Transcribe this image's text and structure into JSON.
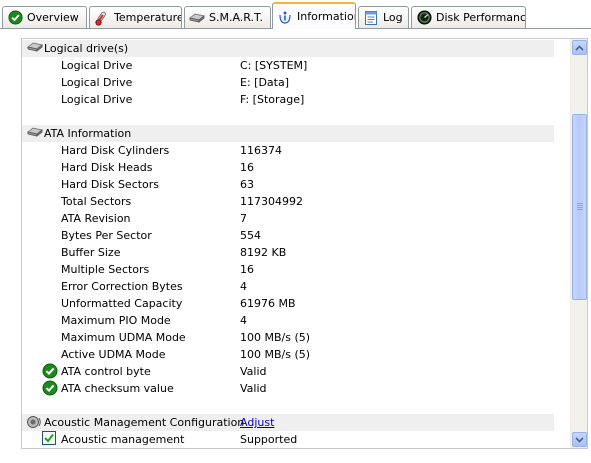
{
  "tabs": [
    {
      "label": "Overview",
      "icon": "check-circle-icon",
      "active": false
    },
    {
      "label": "Temperature",
      "icon": "thermometer-icon",
      "active": false
    },
    {
      "label": "S.M.A.R.T.",
      "icon": "hard-disk-icon",
      "active": false
    },
    {
      "label": "Information",
      "icon": "info-icon",
      "active": true
    },
    {
      "label": "Log",
      "icon": "document-icon",
      "active": false
    },
    {
      "label": "Disk Performance",
      "icon": "gauge-icon",
      "active": false
    }
  ],
  "logical": {
    "header": "Logical drive(s)",
    "rows": [
      {
        "key": "Logical Drive",
        "value": "C: [SYSTEM]"
      },
      {
        "key": "Logical Drive",
        "value": "E: [Data]"
      },
      {
        "key": "Logical Drive",
        "value": "F: [Storage]"
      }
    ]
  },
  "ata": {
    "header": "ATA Information",
    "rows": [
      {
        "key": "Hard Disk Cylinders",
        "value": "116374"
      },
      {
        "key": "Hard Disk Heads",
        "value": "16"
      },
      {
        "key": "Hard Disk Sectors",
        "value": "63"
      },
      {
        "key": "Total Sectors",
        "value": "117304992"
      },
      {
        "key": "ATA Revision",
        "value": "7"
      },
      {
        "key": "Bytes Per Sector",
        "value": "554"
      },
      {
        "key": "Buffer Size",
        "value": "8192 KB"
      },
      {
        "key": "Multiple Sectors",
        "value": "16"
      },
      {
        "key": "Error Correction Bytes",
        "value": "4"
      },
      {
        "key": "Unformatted Capacity",
        "value": "61976 MB"
      },
      {
        "key": "Maximum PIO Mode",
        "value": "4"
      },
      {
        "key": "Maximum UDMA Mode",
        "value": "100 MB/s (5)"
      },
      {
        "key": "Active UDMA Mode",
        "value": "100 MB/s (5)"
      },
      {
        "key": "ATA control byte",
        "value": "Valid",
        "icon": "check-circle-icon"
      },
      {
        "key": "ATA checksum value",
        "value": "Valid",
        "icon": "check-circle-icon"
      }
    ]
  },
  "acoustic": {
    "header": "Acoustic Management Configuration",
    "action": "Adjust",
    "rows": [
      {
        "key": "Acoustic management",
        "value": "Supported",
        "checked": true
      }
    ]
  },
  "scrollbar": {
    "position": 0.32
  }
}
